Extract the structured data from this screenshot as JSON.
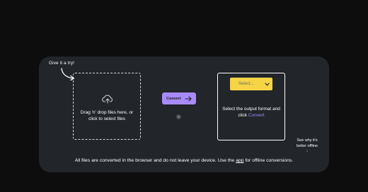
{
  "hint": {
    "try_label": "Give it a try!"
  },
  "dropzone": {
    "icon": "upload-cloud-icon",
    "text": "Drag 'n' drop files here, or click to select files"
  },
  "convert": {
    "label": "Convert",
    "icon": "arrow-right-icon",
    "settings_icon": "gear-icon"
  },
  "output": {
    "select_value": "Select...",
    "text_before": "Select the output format and click ",
    "text_link": "Convert"
  },
  "offline_note": {
    "text": "See why it's better offline",
    "arrow": "↓"
  },
  "footer": {
    "text_before": "All files are converted in the browser and do not leave your device. Use the ",
    "link": "app",
    "text_after": " for offline conversions."
  },
  "colors": {
    "background": "#0d0d0d",
    "panel": "#222529",
    "convert_button": "#a78bfa",
    "select_box": "#f5d547",
    "link": "#a78bfa"
  }
}
